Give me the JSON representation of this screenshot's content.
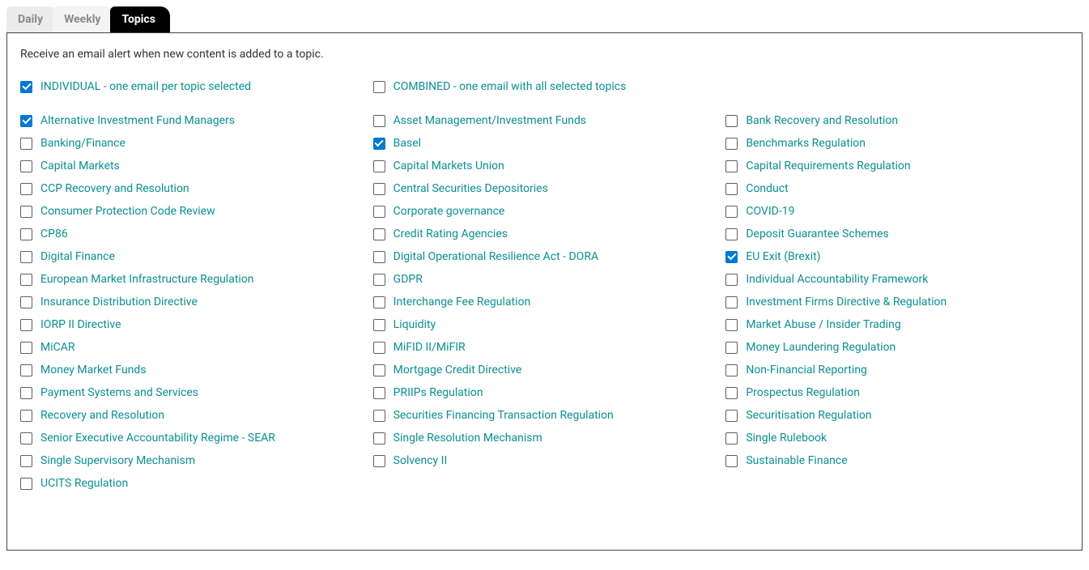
{
  "tabs": [
    {
      "label": "Daily",
      "active": false
    },
    {
      "label": "Weekly",
      "active": false
    },
    {
      "label": "Topics",
      "active": true
    }
  ],
  "intro": "Receive an email alert when new content is added to a topic.",
  "modes": {
    "individual": {
      "label": "INDIVIDUAL - one email per topic selected",
      "checked": true
    },
    "combined": {
      "label": "COMBINED - one email with all selected topics",
      "checked": false
    }
  },
  "topics_rows": [
    [
      {
        "label": "Alternative Investment Fund Managers",
        "checked": true
      },
      {
        "label": "Asset Management/Investment Funds",
        "checked": false
      },
      {
        "label": "Bank Recovery and Resolution",
        "checked": false
      }
    ],
    [
      {
        "label": "Banking/Finance",
        "checked": false
      },
      {
        "label": "Basel",
        "checked": true
      },
      {
        "label": "Benchmarks Regulation",
        "checked": false
      }
    ],
    [
      {
        "label": "Capital Markets",
        "checked": false
      },
      {
        "label": "Capital Markets Union",
        "checked": false
      },
      {
        "label": "Capital Requirements Regulation",
        "checked": false
      }
    ],
    [
      {
        "label": "CCP Recovery and Resolution",
        "checked": false
      },
      {
        "label": "Central Securities Depositories",
        "checked": false
      },
      {
        "label": "Conduct",
        "checked": false
      }
    ],
    [
      {
        "label": "Consumer Protection Code Review",
        "checked": false
      },
      {
        "label": "Corporate governance",
        "checked": false
      },
      {
        "label": "COVID-19",
        "checked": false
      }
    ],
    [
      {
        "label": "CP86",
        "checked": false
      },
      {
        "label": "Credit Rating Agencies",
        "checked": false
      },
      {
        "label": "Deposit Guarantee Schemes",
        "checked": false
      }
    ],
    [
      {
        "label": "Digital Finance",
        "checked": false
      },
      {
        "label": "Digital Operational Resilience Act - DORA",
        "checked": false
      },
      {
        "label": "EU Exit (Brexit)",
        "checked": true
      }
    ],
    [
      {
        "label": "European Market Infrastructure Regulation",
        "checked": false
      },
      {
        "label": "GDPR",
        "checked": false
      },
      {
        "label": "Individual Accountability Framework",
        "checked": false
      }
    ],
    [
      {
        "label": "Insurance Distribution Directive",
        "checked": false
      },
      {
        "label": "Interchange Fee Regulation",
        "checked": false
      },
      {
        "label": "Investment Firms Directive & Regulation",
        "checked": false
      }
    ],
    [
      {
        "label": "IORP II Directive",
        "checked": false
      },
      {
        "label": "Liquidity",
        "checked": false
      },
      {
        "label": "Market Abuse / Insider Trading",
        "checked": false
      }
    ],
    [
      {
        "label": "MiCAR",
        "checked": false
      },
      {
        "label": "MiFID II/MiFIR",
        "checked": false
      },
      {
        "label": "Money Laundering Regulation",
        "checked": false
      }
    ],
    [
      {
        "label": "Money Market Funds",
        "checked": false
      },
      {
        "label": "Mortgage Credit Directive",
        "checked": false
      },
      {
        "label": "Non-Financial Reporting",
        "checked": false
      }
    ],
    [
      {
        "label": "Payment Systems and Services",
        "checked": false
      },
      {
        "label": "PRIIPs Regulation",
        "checked": false
      },
      {
        "label": "Prospectus Regulation",
        "checked": false
      }
    ],
    [
      {
        "label": "Recovery and Resolution",
        "checked": false
      },
      {
        "label": "Securities Financing Transaction Regulation",
        "checked": false
      },
      {
        "label": "Securitisation Regulation",
        "checked": false
      }
    ],
    [
      {
        "label": "Senior Executive Accountability Regime - SEAR",
        "checked": false
      },
      {
        "label": "Single Resolution Mechanism",
        "checked": false
      },
      {
        "label": "Single Rulebook",
        "checked": false
      }
    ],
    [
      {
        "label": "Single Supervisory Mechanism",
        "checked": false
      },
      {
        "label": "Solvency II",
        "checked": false
      },
      {
        "label": "Sustainable Finance",
        "checked": false
      }
    ],
    [
      {
        "label": "UCITS Regulation",
        "checked": false
      }
    ]
  ]
}
